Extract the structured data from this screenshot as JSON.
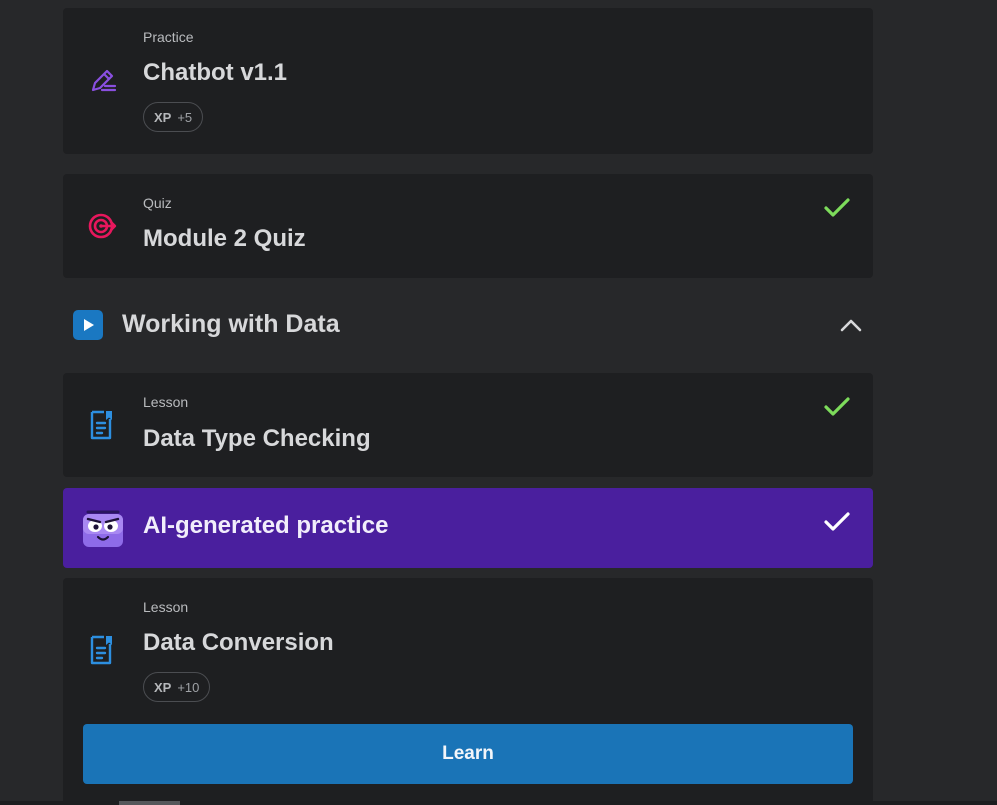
{
  "items": [
    {
      "kind": "Practice",
      "title": "Chatbot v1.1",
      "xp_label": "XP",
      "xp_value": "+5"
    },
    {
      "kind": "Quiz",
      "title": "Module 2 Quiz"
    }
  ],
  "section": {
    "title": "Working with Data"
  },
  "lessons": [
    {
      "kind": "Lesson",
      "title": "Data Type Checking"
    }
  ],
  "ai_practice": {
    "title": "AI-generated practice"
  },
  "current_lesson": {
    "kind": "Lesson",
    "title": "Data Conversion",
    "xp_label": "XP",
    "xp_value": "+10",
    "button_label": "Learn"
  },
  "colors": {
    "practice_icon": "#8a4fe0",
    "quiz_icon": "#e8175d",
    "lesson_icon": "#2d8fe0",
    "check": "#7ddc5b",
    "ai_bg": "#4a1f9e",
    "learn_button": "#1a74b7"
  },
  "icons": {
    "practice": "pencil-edit-icon",
    "quiz": "target-icon",
    "lesson": "document-icon",
    "section": "play-icon",
    "collapse": "chevron-up-icon",
    "done": "check-icon"
  }
}
